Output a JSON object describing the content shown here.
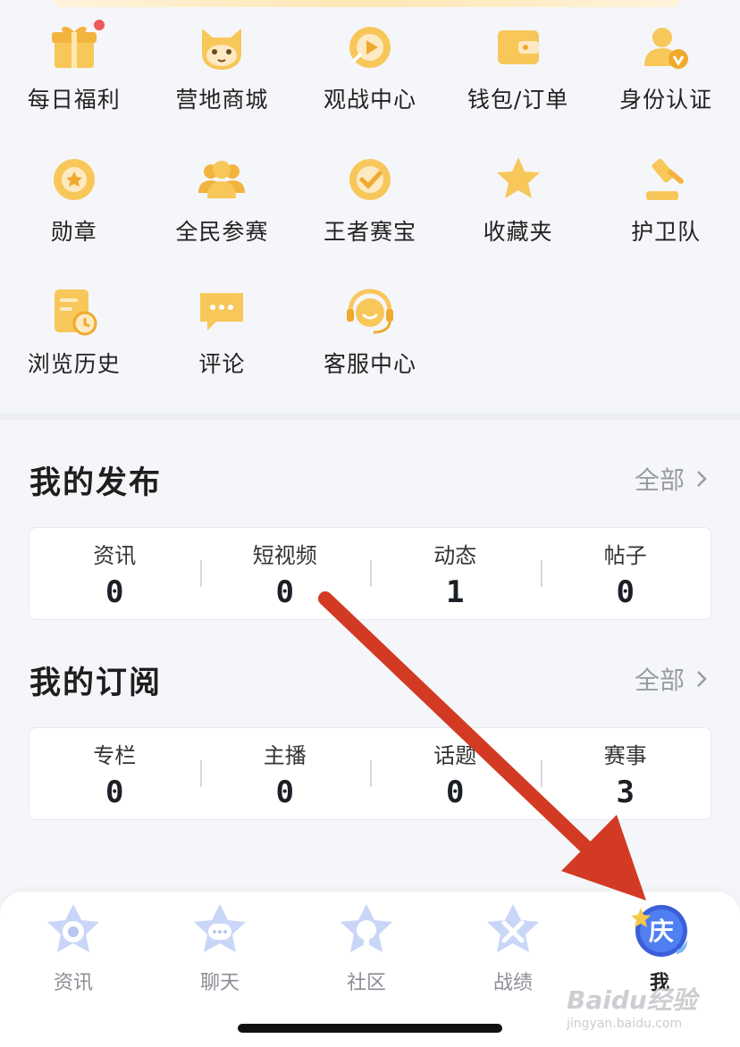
{
  "colors": {
    "accent_yellow": "#f8c75a",
    "accent_dark_yellow": "#f0a92c",
    "arrow_red": "#d33a24"
  },
  "shortcuts": [
    {
      "label": "每日福利",
      "icon": "gift-icon"
    },
    {
      "label": "营地商城",
      "icon": "cat-mascot-icon"
    },
    {
      "label": "观战中心",
      "icon": "play-circle-icon"
    },
    {
      "label": "钱包/订单",
      "icon": "wallet-icon"
    },
    {
      "label": "身份认证",
      "icon": "verified-user-icon"
    },
    {
      "label": "勋章",
      "icon": "medal-icon"
    },
    {
      "label": "全民参赛",
      "icon": "team-icon"
    },
    {
      "label": "王者赛宝",
      "icon": "check-circle-icon"
    },
    {
      "label": "收藏夹",
      "icon": "star-icon"
    },
    {
      "label": "护卫队",
      "icon": "gavel-icon"
    },
    {
      "label": "浏览历史",
      "icon": "history-doc-icon"
    },
    {
      "label": "评论",
      "icon": "comment-icon"
    },
    {
      "label": "客服中心",
      "icon": "headset-icon"
    }
  ],
  "publish": {
    "title": "我的发布",
    "more": "全部",
    "stats": [
      {
        "label": "资讯",
        "value": "0"
      },
      {
        "label": "短视频",
        "value": "0"
      },
      {
        "label": "动态",
        "value": "1"
      },
      {
        "label": "帖子",
        "value": "0"
      }
    ]
  },
  "subscribe": {
    "title": "我的订阅",
    "more": "全部",
    "stats": [
      {
        "label": "专栏",
        "value": "0"
      },
      {
        "label": "主播",
        "value": "0"
      },
      {
        "label": "话题",
        "value": "0"
      },
      {
        "label": "赛事",
        "value": "3"
      }
    ]
  },
  "tabbar": [
    {
      "label": "资讯",
      "icon": "news-star-icon"
    },
    {
      "label": "聊天",
      "icon": "chat-star-icon"
    },
    {
      "label": "社区",
      "icon": "community-star-icon"
    },
    {
      "label": "战绩",
      "icon": "swords-star-icon"
    },
    {
      "label": "我",
      "icon": "celebration-avatar-icon",
      "badge": "庆",
      "active": true
    }
  ],
  "watermark": {
    "brand": "Baidu经验",
    "url": "jingyan.baidu.com"
  }
}
